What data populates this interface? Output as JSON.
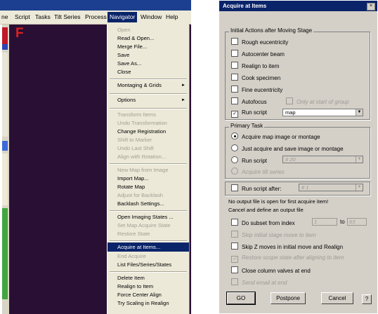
{
  "menubar": {
    "items": [
      {
        "label": "ne"
      },
      {
        "label": "Script"
      },
      {
        "label": "Tasks"
      },
      {
        "label": "Tilt Series"
      },
      {
        "label": "Process"
      },
      {
        "label": "Navigator"
      },
      {
        "label": "Window"
      },
      {
        "label": "Help"
      }
    ],
    "active": "Navigator"
  },
  "workspace": {
    "marker": "F"
  },
  "navigator_menu": {
    "items": [
      {
        "label": "Open",
        "enabled": false
      },
      {
        "label": "Read & Open...",
        "enabled": true
      },
      {
        "label": "Merge File...",
        "enabled": true
      },
      {
        "label": "Save",
        "enabled": true
      },
      {
        "label": "Save As...",
        "enabled": true
      },
      {
        "label": "Close",
        "enabled": true
      },
      {
        "label": "Montaging & Grids",
        "enabled": true,
        "submenu": true
      },
      {
        "label": "Options",
        "enabled": true,
        "submenu": true
      },
      {
        "label": "Transform Items",
        "enabled": false
      },
      {
        "label": "Undo Transformation",
        "enabled": false
      },
      {
        "label": "Change Registration",
        "enabled": true
      },
      {
        "label": "Shift to Marker",
        "enabled": false
      },
      {
        "label": "Undo Last Shift",
        "enabled": false
      },
      {
        "label": "Align with Rotation...",
        "enabled": false
      },
      {
        "label": "New Map from Image",
        "enabled": false
      },
      {
        "label": "Import Map...",
        "enabled": true
      },
      {
        "label": "Rotate Map",
        "enabled": true
      },
      {
        "label": "Adjust for Backlash",
        "enabled": false
      },
      {
        "label": "Backlash Settings...",
        "enabled": true
      },
      {
        "label": "Open Imaging States ...",
        "enabled": true
      },
      {
        "label": "Set Map Acquire State",
        "enabled": false
      },
      {
        "label": "Restore State",
        "enabled": false
      },
      {
        "label": "Acquire at Items...",
        "enabled": true,
        "highlighted": true
      },
      {
        "label": "End Acquire",
        "enabled": false
      },
      {
        "label": "List Files/Series/States",
        "enabled": true
      },
      {
        "label": "Delete Item",
        "enabled": true
      },
      {
        "label": "Realign to Item",
        "enabled": true
      },
      {
        "label": "Force Center Align",
        "enabled": true
      },
      {
        "label": "Try Scaling in Realign",
        "enabled": true
      }
    ]
  },
  "dialog": {
    "title": "Acquire at Items",
    "close_glyph": "×",
    "initial_actions": {
      "label": "Initial Actions after Moving Stage",
      "options": [
        {
          "label": "Rough eucentricity",
          "checked": false
        },
        {
          "label": "Autocenter beam",
          "checked": false
        },
        {
          "label": "Realign to item",
          "checked": false
        },
        {
          "label": "Cook specimen",
          "checked": false
        },
        {
          "label": "Fine eucentricity",
          "checked": false
        },
        {
          "label": "Autofocus",
          "checked": false
        },
        {
          "label": "Run script",
          "checked": true
        }
      ],
      "only_at_start": {
        "label": "Only at start of group",
        "checked": false,
        "enabled": false
      },
      "script_select": "map"
    },
    "primary_task": {
      "label": "Primary Task",
      "options": [
        {
          "label": "Acquire map image or montage",
          "selected": true,
          "enabled": true
        },
        {
          "label": "Just acquire and save image or montage",
          "selected": false,
          "enabled": true
        },
        {
          "label": "Run script",
          "selected": false,
          "enabled": true
        },
        {
          "label": "Acquire tilt series",
          "selected": false,
          "enabled": false
        }
      ],
      "script_select": "# 20"
    },
    "run_script_after": {
      "label": "Run script after:",
      "checked": false,
      "select": "# 1"
    },
    "note_line1": "No output file is open for first acquire item!",
    "note_line2": "Cancel and define an output file",
    "subset": {
      "label": "Do subset from index",
      "checked": false,
      "from": "1",
      "to_label": "to",
      "to": "63"
    },
    "skip_initial": {
      "label": "Skip initial stage move to item",
      "checked": false,
      "enabled": false
    },
    "skip_z": {
      "label": "Skip Z moves in initial move and Realign",
      "checked": false,
      "enabled": true
    },
    "restore_scope": {
      "label": "Restore scope state after aligning to item",
      "checked": true,
      "enabled": false
    },
    "close_valves": {
      "label": "Close column valves at end",
      "checked": false,
      "enabled": true
    },
    "send_email": {
      "label": "Send email at end",
      "checked": false,
      "enabled": false
    },
    "buttons": {
      "go": "GO",
      "postpone": "Postpone",
      "cancel": "Cancel",
      "help": "?"
    }
  }
}
